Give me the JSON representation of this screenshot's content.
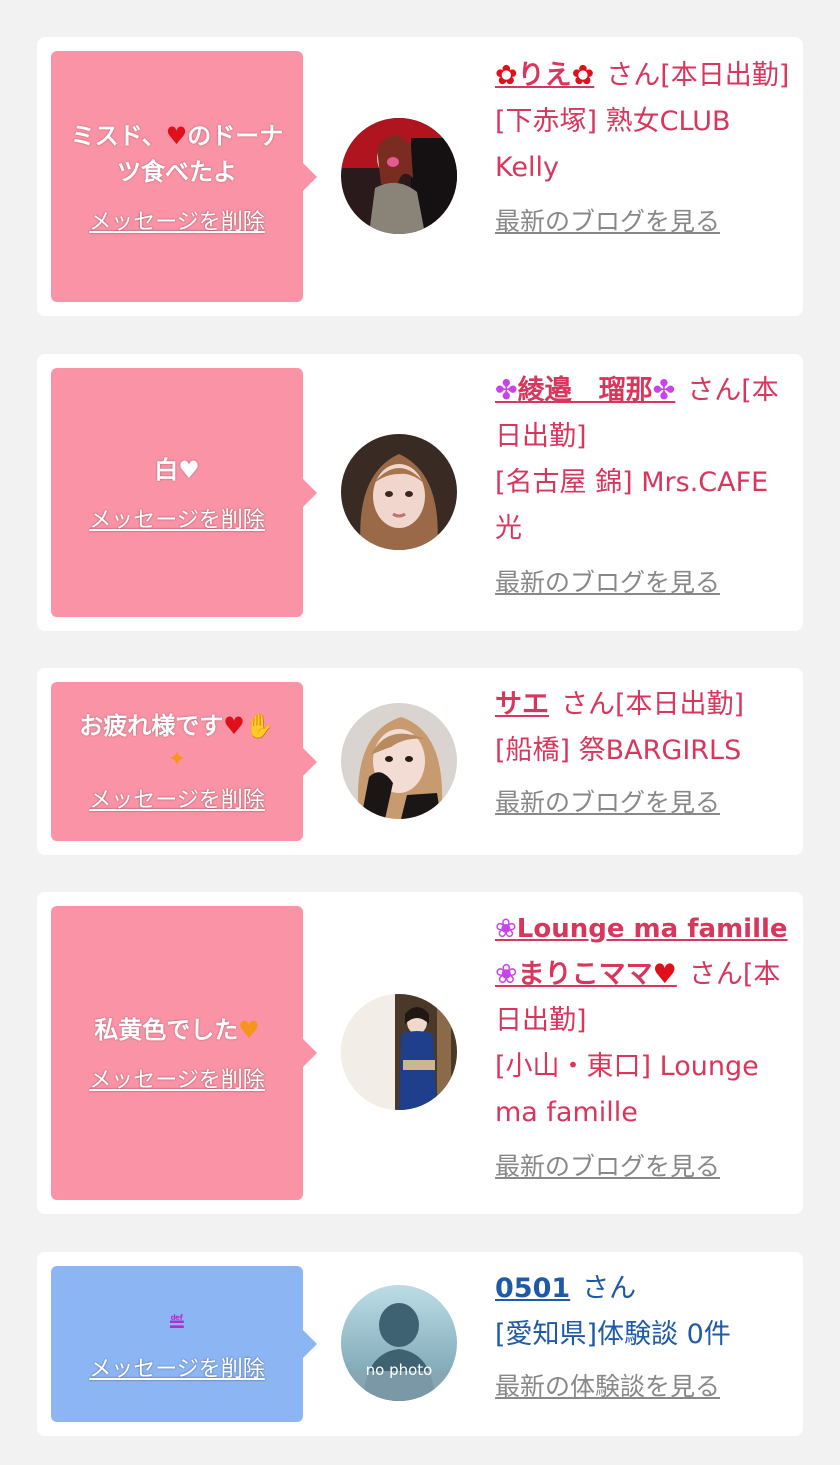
{
  "entries": [
    {
      "message": "ミスド、",
      "message2": "のドーナツ食べたよ",
      "delete_label": "メッセージを削除",
      "name": "りえ",
      "name_suffix": "さん[本日出勤]",
      "shop": "[下赤塚] 熟女CLUB Kelly",
      "blog_label": "最新のブログを見る"
    },
    {
      "message": "白",
      "delete_label": "メッセージを削除",
      "name": "綾邉　瑠那",
      "name_suffix": "さん[本日出勤]",
      "shop": "[名古屋 錦] Mrs.CAFE 光",
      "blog_label": "最新のブログを見る"
    },
    {
      "message": "お疲れ様です",
      "delete_label": "メッセージを削除",
      "name": "サエ",
      "name_suffix": "さん[本日出勤]",
      "shop": "[船橋] 祭BARGIRLS",
      "blog_label": "最新のブログを見る"
    },
    {
      "message": "私黄色でした",
      "delete_label": "メッセージを削除",
      "name": "Lounge ma famille",
      "name2": "まりこママ",
      "name_suffix": "さん[本日出勤]",
      "shop": "[小山・東口] Lounge ma famille",
      "blog_label": "最新のブログを見る"
    },
    {
      "message": "",
      "delete_label": "メッセージを削除",
      "name": "0501",
      "name_suffix": "さん",
      "shop": "[愛知県]体験談 0件",
      "blog_label": "最新の体験談を見る",
      "avatar_text": "no photo"
    }
  ],
  "colors": {
    "pink_bubble": "#fb93a6",
    "blue_bubble": "#8cb6f3",
    "cast_text": "#d9365d",
    "user_text": "#1e5aa8",
    "link_gray": "#888888"
  }
}
